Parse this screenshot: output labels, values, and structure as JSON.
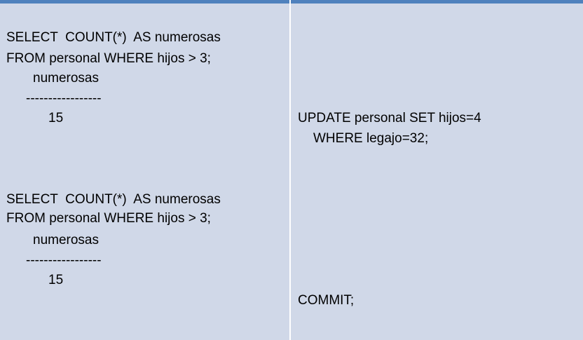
{
  "left_column": {
    "query1": {
      "line1": "SELECT  COUNT(*)  AS numerosas",
      "line2": "FROM personal WHERE hijos > 3;",
      "column_header": "numerosas",
      "separator": "-----------------",
      "value": "15"
    },
    "query2": {
      "line1": "SELECT  COUNT(*)  AS numerosas",
      "line2": "FROM personal WHERE hijos > 3;",
      "column_header": "numerosas",
      "separator": "-----------------",
      "value": "15"
    }
  },
  "right_column": {
    "update_line1": "UPDATE personal SET hijos=4",
    "update_line2": "WHERE legajo=32;",
    "commit": "COMMIT;"
  },
  "colors": {
    "background": "#d0d8e8",
    "header_rule": "#4f81bd",
    "divider": "#ffffff",
    "text": "#000000"
  }
}
